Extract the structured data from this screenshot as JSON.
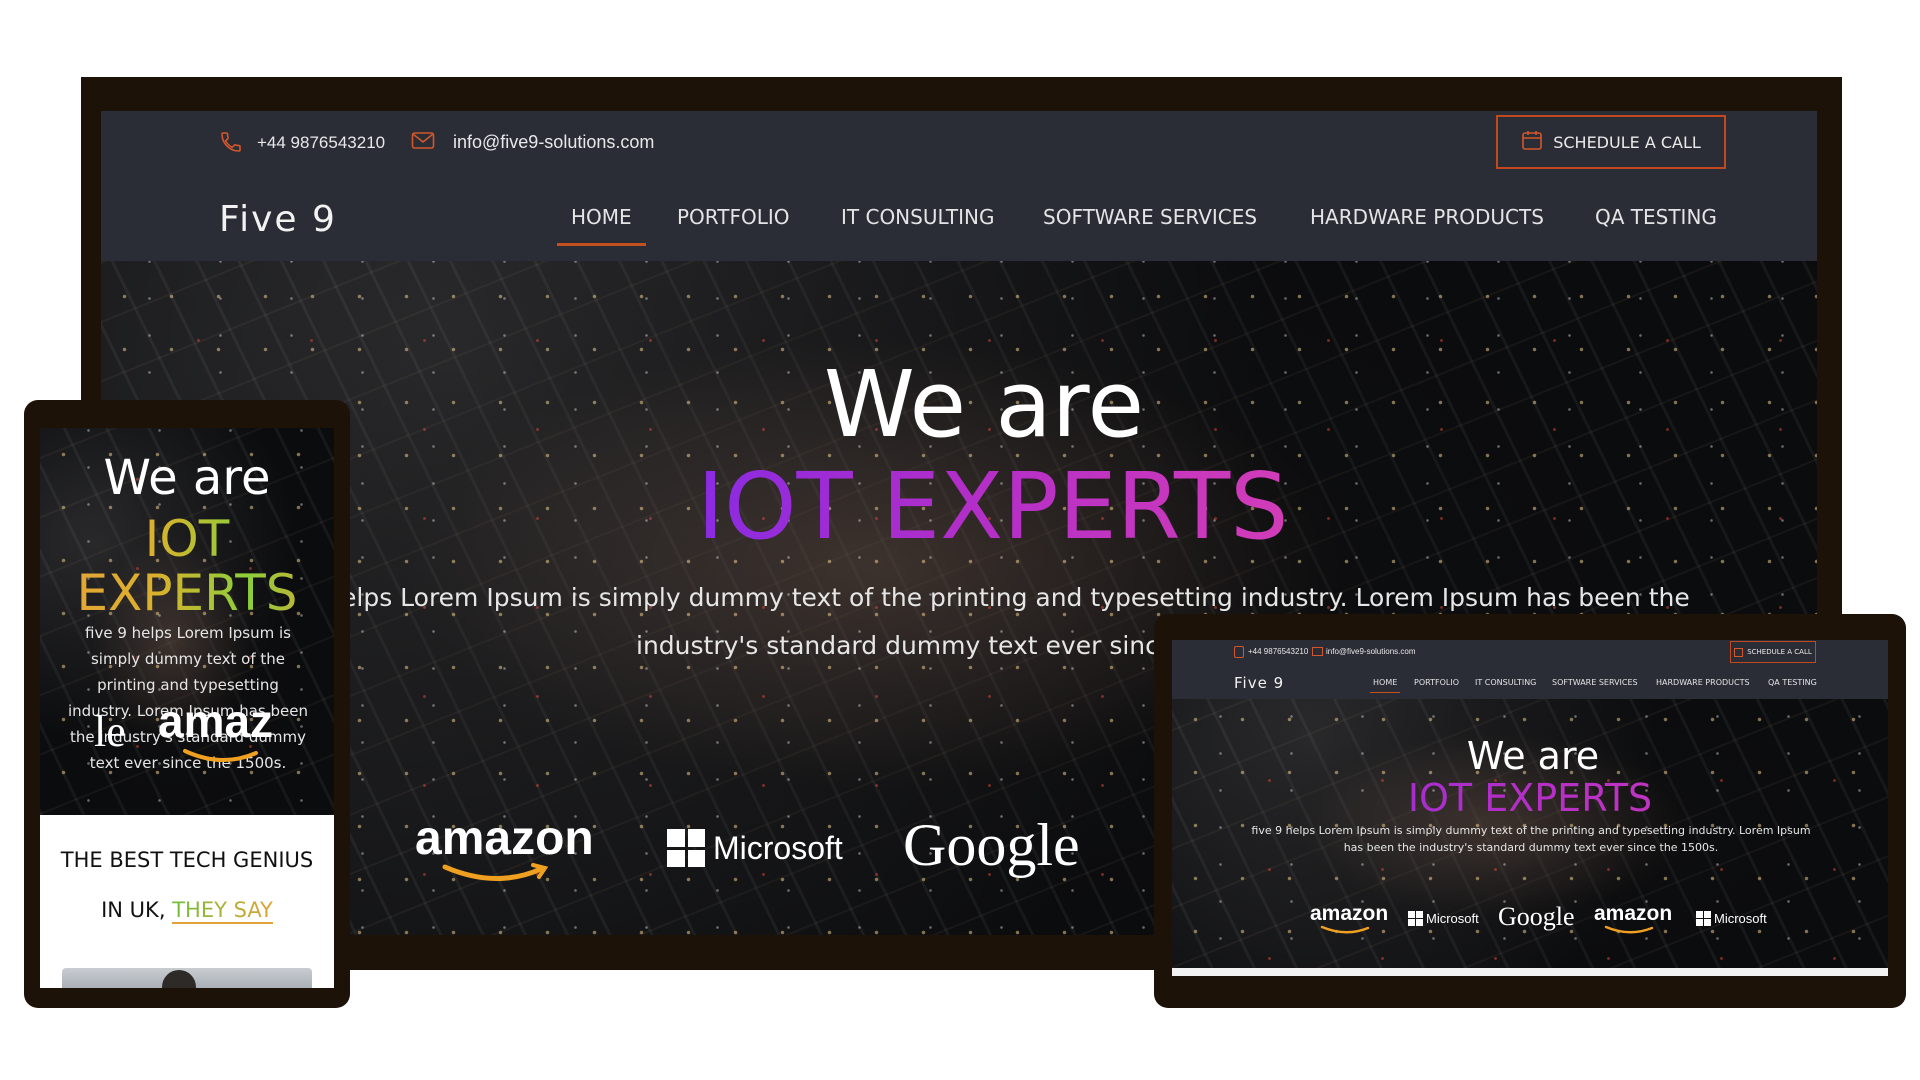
{
  "site": {
    "phone": "+44 9876543210",
    "email": "info@five9-solutions.com",
    "cta": "SCHEDULE A CALL",
    "brand": "Five 9",
    "nav": [
      "HOME",
      "PORTFOLIO",
      "IT CONSULTING",
      "SOFTWARE SERVICES",
      "HARDWARE PRODUCTS",
      "QA TESTING"
    ],
    "active_nav": "HOME",
    "hero_line1": "We are",
    "hero_line2": "IOT EXPERTS",
    "hero_line2_mobile_a": "IOT",
    "hero_line2_mobile_b": "EXPERTS",
    "desktop_desc_1": "elps Lorem Ipsum is simply dummy text of the printing and typesetting industry. Lorem Ipsum has been the",
    "desktop_desc_2": "industry's standard dummy text ever sinc",
    "tablet_desc": "five 9 helps Lorem Ipsum is simply dummy text of the printing and typesetting industry. Lorem Ipsum has been the industry's standard dummy text ever since the 1500s.",
    "mobile_desc": "five 9 helps Lorem Ipsum is simply dummy text of the printing and typesetting industry. Lorem Ipsum has been the industry's standard dummy text ever since the 1500s.",
    "logos": {
      "amazon": "amazon",
      "microsoft": "Microsoft",
      "google": "Google"
    },
    "mobile_logo_partial_left": "le",
    "mobile_logo_partial_right": "amaz",
    "mobile_section_title_1": "THE BEST TECH GENIUS",
    "mobile_section_title_2_prefix": "IN UK,",
    "mobile_section_title_2_highlight": "THEY SAY"
  },
  "colors": {
    "frame": "#1c1208",
    "header_bg": "#2a2d35",
    "accent_orange": "#c4501f",
    "iot_purple": "#b22ec8"
  },
  "icons": [
    "phone-icon",
    "mail-icon",
    "calendar-icon",
    "amazon-logo",
    "microsoft-logo",
    "google-logo"
  ]
}
